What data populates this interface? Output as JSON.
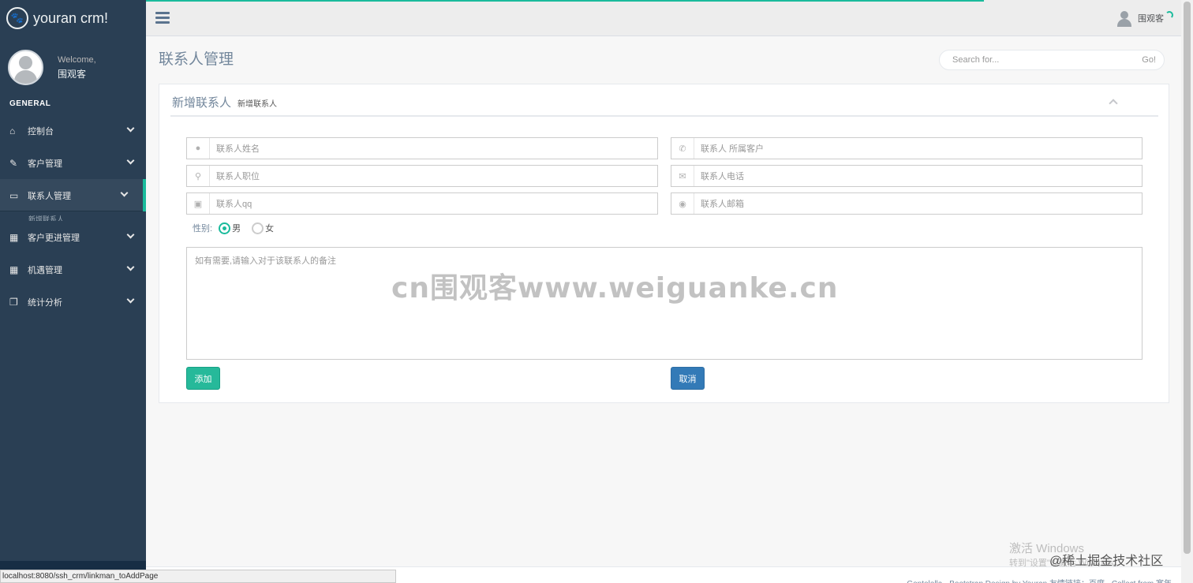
{
  "brand": {
    "name": "youran crm!",
    "icon": "paw-icon"
  },
  "profile": {
    "welcome": "Welcome,",
    "name": "围观客"
  },
  "sidebar": {
    "section": "GENERAL",
    "items": [
      {
        "label": "控制台",
        "icon": "home-icon"
      },
      {
        "label": "客户管理",
        "icon": "edit-icon"
      },
      {
        "label": "联系人管理",
        "icon": "desktop-icon"
      },
      {
        "label": "客户更进管理",
        "icon": "table-icon"
      },
      {
        "label": "机遇管理",
        "icon": "table-icon"
      },
      {
        "label": "统计分析",
        "icon": "clone-icon"
      }
    ],
    "sub_label": "新增联系人"
  },
  "topnav": {
    "user": "围观客"
  },
  "page": {
    "title": "联系人管理"
  },
  "search": {
    "placeholder": "Search for...",
    "go": "Go!"
  },
  "panel": {
    "title": "新增联系人",
    "subtitle": "新增联系人"
  },
  "form": {
    "name_ph": "联系人姓名",
    "customer_ph": "联系人 所属客户",
    "position_ph": "联系人职位",
    "phone_ph": "联系人电话",
    "qq_ph": "联系人qq",
    "email_ph": "联系人邮箱",
    "gender_label": "性别:",
    "male": "男",
    "female": "女",
    "note_ph": "如有需要,请输入对于该联系人的备注",
    "add": "添加",
    "cancel": "取消"
  },
  "watermark": "cn围观客www.weiguanke.cn",
  "footer": {
    "text": "Gentelella - Bootstrap Design by Youran 友情链接：百度 - Collect from 宽年"
  },
  "status_url": "localhost:8080/ssh_crm/linkman_toAddPage",
  "windows": {
    "line1": "激活 Windows",
    "line2": "转到\"设置\"以激活 Windows。"
  },
  "juejin": "@稀土掘金技术社区",
  "colors": {
    "sidebar": "#2A3F54",
    "accent": "#1ABB9C",
    "primary": "#337AB7",
    "success": "#26B99A"
  }
}
